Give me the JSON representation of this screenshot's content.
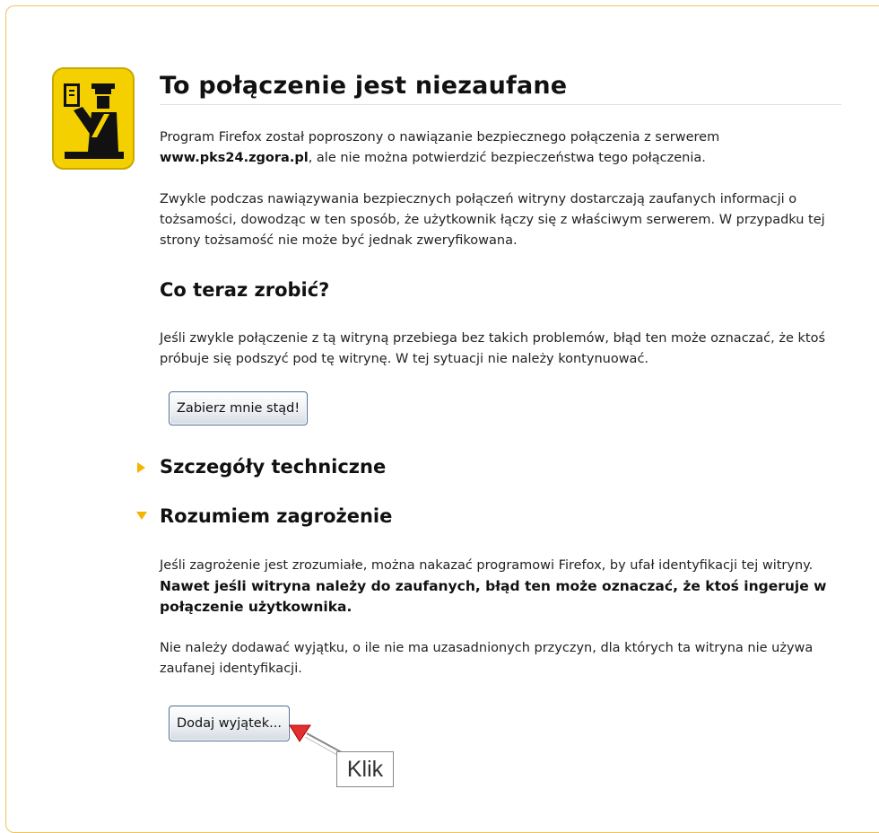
{
  "page": {
    "title": "To połączenie jest niezaufane",
    "intro_text_1": "Program Firefox został poproszony o nawiązanie bezpiecznego połączenia z serwerem",
    "intro_host": "www.pks24.zgora.pl",
    "intro_text_2": ", ale nie można potwierdzić bezpieczeństwa tego połączenia.",
    "identity_paragraph": "Zwykle podczas nawiązywania bezpiecznych połączeń witryny dostarczają zaufanych informacji o tożsamości, dowodząc w ten sposób, że użytkownik łączy się z właściwym serwerem. W przypadku tej strony tożsamość nie może być jednak zweryfikowana.",
    "what_now_heading": "Co teraz zrobić?",
    "what_now_paragraph": "Jeśli zwykle połączenie z tą witryną przebiega bez takich problemów, błąd ten może oznaczać, że ktoś próbuje się podszyć pod tę witrynę. W tej sytuacji nie należy kontynuować.",
    "get_me_out_button": "Zabierz mnie stąd!",
    "technical_details_heading": "Szczegóły techniczne",
    "understand_risks_heading": "Rozumiem zagrożenie",
    "risks_paragraph_1": "Jeśli zagrożenie jest zrozumiałe, można nakazać programowi Firefox, by ufał identyfikacji tej witryny.",
    "risks_paragraph_bold": "Nawet jeśli witryna należy do zaufanych, błąd ten może oznaczać, że ktoś ingeruje w połączenie użytkownika.",
    "risks_paragraph_2": "Nie należy dodawać wyjątku, o ile nie ma uzasadnionych przyczyn, dla których ta witryna nie używa zaufanej identyfikacji.",
    "add_exception_button": "Dodaj wyjątek..."
  },
  "annotation": {
    "callout_label": "Klik",
    "arrow_color": "#e03030"
  },
  "colors": {
    "panel_border": "#f0c45a",
    "icon_yellow": "#f5d000",
    "twisty": "#f5b400"
  },
  "icons": {
    "alert": "policeman-icon",
    "collapsed": "triangle-right-icon",
    "expanded": "triangle-down-icon"
  }
}
